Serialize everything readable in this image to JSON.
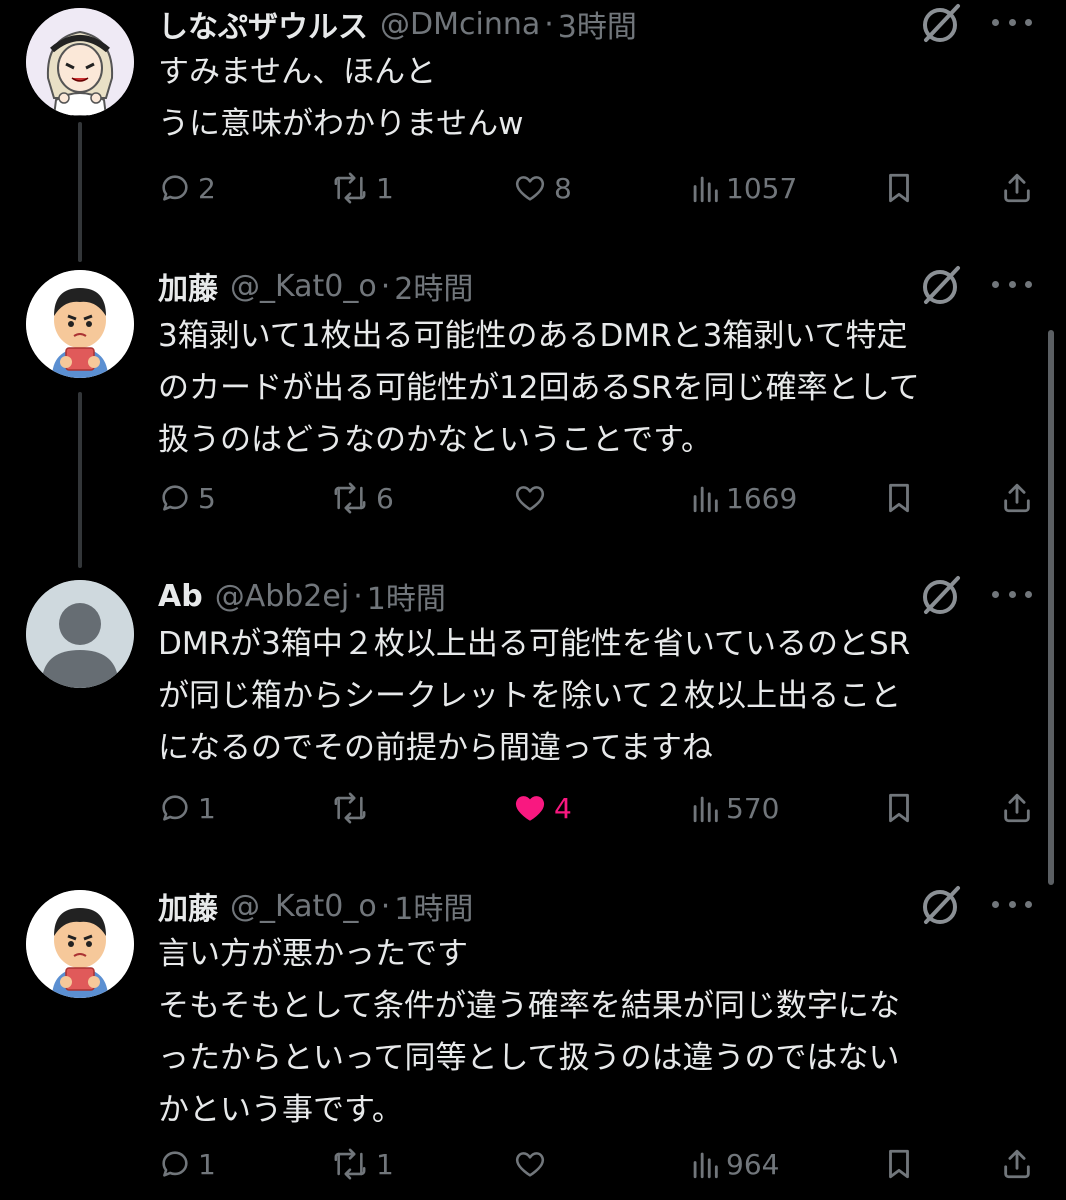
{
  "posts": [
    {
      "name": "しなぷザウルス",
      "handle": "@DMcinna",
      "time": "3時間",
      "text": "すみません、ほんと\nうに意味がわかりませんw",
      "replies": "2",
      "reposts": "1",
      "likes": "8",
      "views": "1057",
      "liked": false,
      "avatar": "anime-girl-avatar"
    },
    {
      "name": "加藤",
      "handle": "@_Kat0_o",
      "time": "2時間",
      "text": "3箱剥いて1枚出る可能性のあるDMRと3箱剥いて特定\nのカードが出る可能性が12回あるSRを同じ確率として\n扱うのはどうなのかなということです。",
      "replies": "5",
      "reposts": "6",
      "likes": "",
      "views": "1669",
      "liked": false,
      "avatar": "boy-with-cards-avatar"
    },
    {
      "name": "Ab",
      "handle": "@Abb2ej",
      "time": "1時間",
      "text": "DMRが3箱中２枚以上出る可能性を省いているのとSR\nが同じ箱からシークレットを除いて２枚以上出ること\nになるのでその前提から間違ってますね",
      "replies": "1",
      "reposts": "",
      "likes": "4",
      "views": "570",
      "liked": true,
      "avatar": "default-avatar"
    },
    {
      "name": "加藤",
      "handle": "@_Kat0_o",
      "time": "1時間",
      "text": "言い方が悪かったです\nそもそもとして条件が違う確率を結果が同じ数字にな\nったからといって同等として扱うのは違うのではない\nかという事です。",
      "replies": "1",
      "reposts": "1",
      "likes": "",
      "views": "964",
      "liked": false,
      "avatar": "boy-with-cards-avatar"
    }
  ],
  "colors": {
    "background": "#000000",
    "text": "#e7e9ea",
    "muted": "#71767b",
    "like": "#f91880",
    "thread": "#333639"
  },
  "separator": "·"
}
